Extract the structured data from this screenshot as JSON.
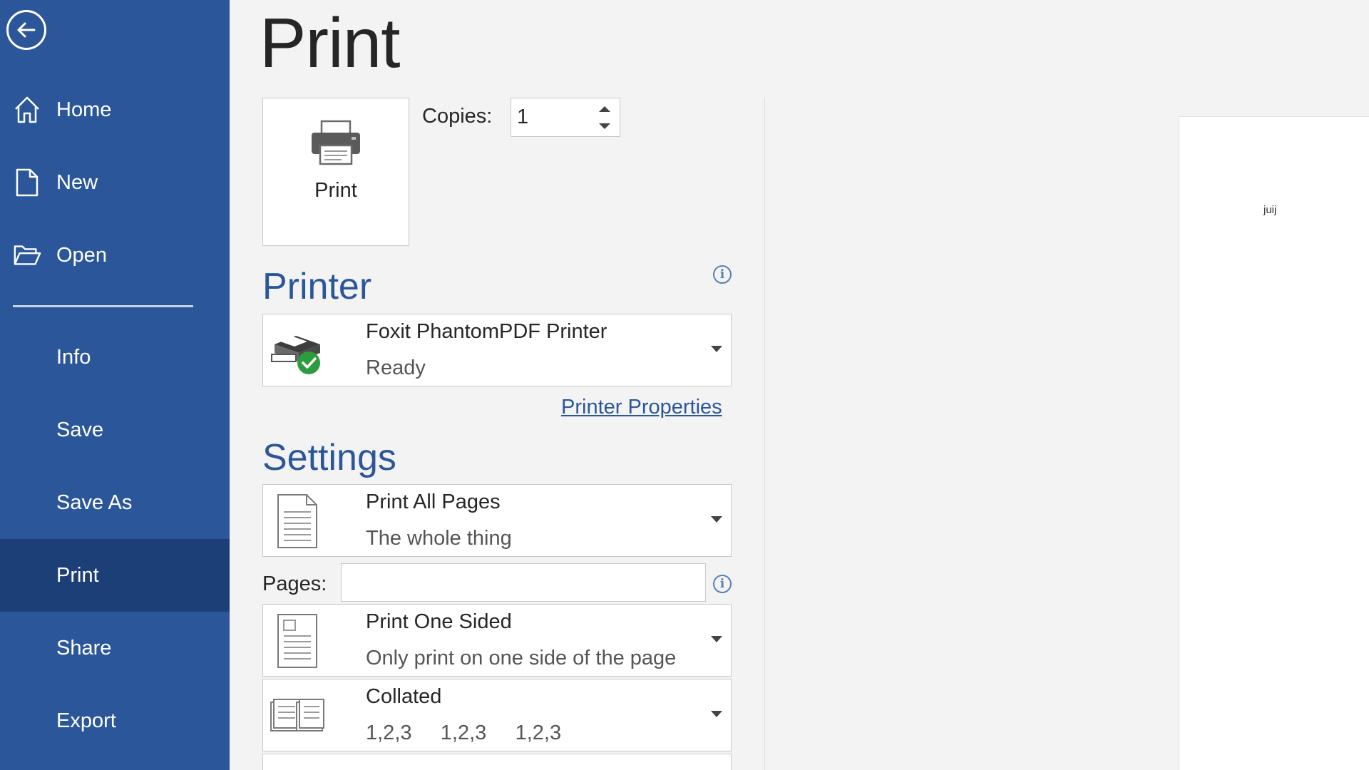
{
  "sidebar": {
    "back_icon": "arrow-left-icon",
    "items": [
      {
        "label": "Home",
        "icon": "home-icon"
      },
      {
        "label": "New",
        "icon": "document-icon"
      },
      {
        "label": "Open",
        "icon": "folder-icon"
      },
      {
        "label": "Info"
      },
      {
        "label": "Save"
      },
      {
        "label": "Save As"
      },
      {
        "label": "Print",
        "active": true
      },
      {
        "label": "Share"
      },
      {
        "label": "Export"
      }
    ],
    "colors": {
      "background": "#2b579a",
      "active": "#1c3f77"
    }
  },
  "main": {
    "title": "Print",
    "print_button": {
      "label": "Print",
      "icon": "printer-icon"
    },
    "copies": {
      "label": "Copies:",
      "value": "1"
    },
    "printer_section": {
      "title": "Printer",
      "selected": {
        "name": "Foxit PhantomPDF Printer",
        "status": "Ready",
        "icon": "printer-ready-icon"
      },
      "properties_link": "Printer Properties"
    },
    "settings_section": {
      "title": "Settings",
      "pages_range": {
        "main": "Print All Pages",
        "sub": "The whole thing",
        "icon": "pages-icon"
      },
      "pages_field": {
        "label": "Pages:",
        "value": ""
      },
      "sides": {
        "main": "Print One Sided",
        "sub": "Only print on one side of the page",
        "icon": "one-sided-icon"
      },
      "collation": {
        "main": "Collated",
        "sub": "1,2,3     1,2,3     1,2,3",
        "icon": "collated-icon"
      }
    },
    "preview": {
      "text": "juij"
    },
    "accent_color": "#2b579a"
  }
}
